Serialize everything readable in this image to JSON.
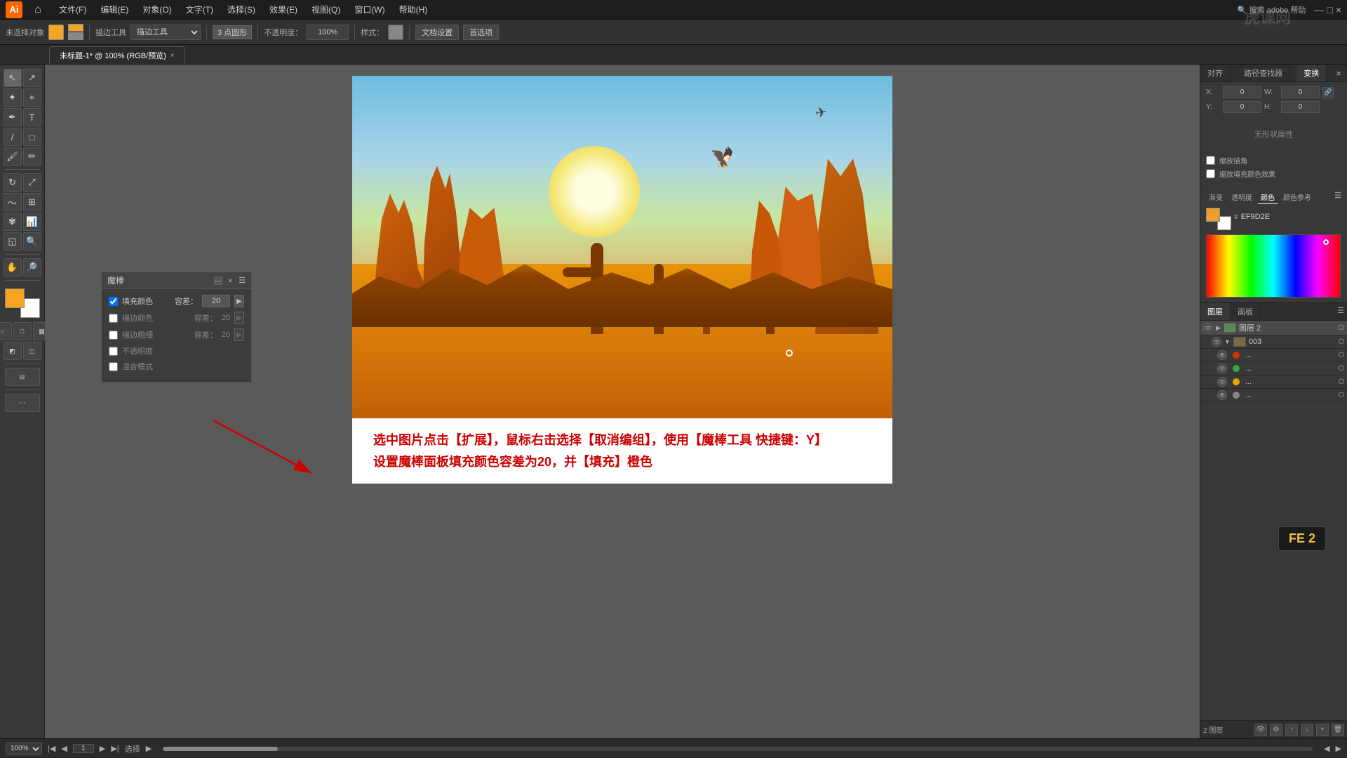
{
  "app": {
    "title": "Adobe Illustrator",
    "logo_text": "Ai"
  },
  "menu": {
    "items": [
      "文件(F)",
      "编辑(E)",
      "对象(O)",
      "文字(T)",
      "选择(S)",
      "效果(E)",
      "视图(Q)",
      "窗口(W)",
      "帮助(H)"
    ]
  },
  "toolbar": {
    "label_no_selection": "未选择对象",
    "label_stroke": "描边：",
    "label_opacity": "不透明度：",
    "opacity_value": "100%",
    "label_style": "样式：",
    "label_brush": "描边工具",
    "label_point": "3 点圆形",
    "btn_doc_settings": "文档设置",
    "btn_preferences": "首选项"
  },
  "tab": {
    "label": "未标题-1* @ 100% (RGB/预览)"
  },
  "magic_wand_panel": {
    "title": "魔棒",
    "fill_color_label": "填充颜色",
    "fill_color_checked": true,
    "fill_tolerance_label": "容差：",
    "fill_tolerance_value": "20",
    "stroke_color_label": "描边颜色",
    "stroke_color_checked": false,
    "stroke_tolerance_label": "容差：",
    "stroke_width_label": "描边粗细",
    "stroke_width_checked": false,
    "stroke_width_tolerance_label": "容差：",
    "opacity_label": "不透明度",
    "opacity_checked": false,
    "blend_mode_label": "混合模式",
    "blend_mode_checked": false
  },
  "right_panel": {
    "tabs": [
      "对齐",
      "路径查找器",
      "变换"
    ],
    "active_tab": "变换",
    "no_status_text": "无形状属性",
    "color_panel": {
      "tabs": [
        "渐变",
        "透明度",
        "颜色",
        "颜色参考"
      ],
      "active_tab": "颜色",
      "hex_label": "#",
      "hex_value": "EF9D2E"
    }
  },
  "layers_panel": {
    "tabs": [
      "图层",
      "画板"
    ],
    "active_tab": "图层",
    "layers": [
      {
        "name": "图层 2",
        "type": "group",
        "visible": true,
        "expanded": true,
        "color": "#4488ff",
        "o": "O"
      },
      {
        "name": "003",
        "type": "sublayer",
        "visible": true,
        "expanded": false,
        "color": "#4488ff",
        "o": "O"
      },
      {
        "name": "...",
        "type": "item",
        "visible": true,
        "color": "#cc3300",
        "o": "O"
      },
      {
        "name": "...",
        "type": "item",
        "visible": true,
        "color": "#33aa44",
        "o": "O"
      },
      {
        "name": "...",
        "type": "item",
        "visible": true,
        "color": "#ddaa00",
        "o": "O"
      },
      {
        "name": "...",
        "type": "item",
        "visible": true,
        "color": "#888888",
        "o": "O"
      }
    ],
    "layer_count_label": "2 图层"
  },
  "instruction": {
    "line1": "选中图片点击【扩展】，鼠标右击选择【取消编组】，使用【魔棒工具 快捷键：Y】",
    "line2": "设置魔棒面板填充颜色容差为20，并【填充】橙色"
  },
  "status_bar": {
    "zoom_value": "100%",
    "page_label": "1",
    "action_label": "选择"
  },
  "fe2": {
    "label": "FE 2"
  },
  "watermark": "虎课网"
}
